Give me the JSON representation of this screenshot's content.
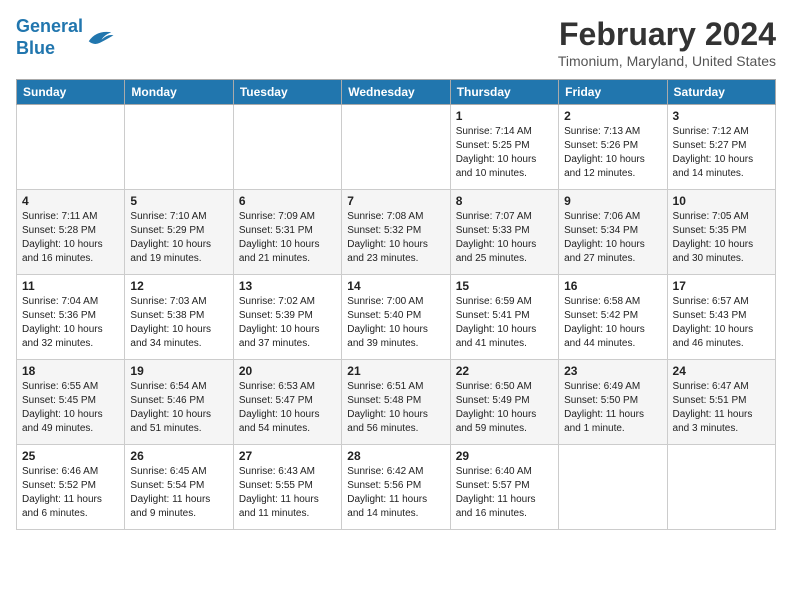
{
  "logo": {
    "line1": "General",
    "line2": "Blue"
  },
  "title": "February 2024",
  "subtitle": "Timonium, Maryland, United States",
  "days_of_week": [
    "Sunday",
    "Monday",
    "Tuesday",
    "Wednesday",
    "Thursday",
    "Friday",
    "Saturday"
  ],
  "weeks": [
    [
      {
        "day": "",
        "sunrise": "",
        "sunset": "",
        "daylight": ""
      },
      {
        "day": "",
        "sunrise": "",
        "sunset": "",
        "daylight": ""
      },
      {
        "day": "",
        "sunrise": "",
        "sunset": "",
        "daylight": ""
      },
      {
        "day": "",
        "sunrise": "",
        "sunset": "",
        "daylight": ""
      },
      {
        "day": "1",
        "sunrise": "Sunrise: 7:14 AM",
        "sunset": "Sunset: 5:25 PM",
        "daylight": "Daylight: 10 hours and 10 minutes."
      },
      {
        "day": "2",
        "sunrise": "Sunrise: 7:13 AM",
        "sunset": "Sunset: 5:26 PM",
        "daylight": "Daylight: 10 hours and 12 minutes."
      },
      {
        "day": "3",
        "sunrise": "Sunrise: 7:12 AM",
        "sunset": "Sunset: 5:27 PM",
        "daylight": "Daylight: 10 hours and 14 minutes."
      }
    ],
    [
      {
        "day": "4",
        "sunrise": "Sunrise: 7:11 AM",
        "sunset": "Sunset: 5:28 PM",
        "daylight": "Daylight: 10 hours and 16 minutes."
      },
      {
        "day": "5",
        "sunrise": "Sunrise: 7:10 AM",
        "sunset": "Sunset: 5:29 PM",
        "daylight": "Daylight: 10 hours and 19 minutes."
      },
      {
        "day": "6",
        "sunrise": "Sunrise: 7:09 AM",
        "sunset": "Sunset: 5:31 PM",
        "daylight": "Daylight: 10 hours and 21 minutes."
      },
      {
        "day": "7",
        "sunrise": "Sunrise: 7:08 AM",
        "sunset": "Sunset: 5:32 PM",
        "daylight": "Daylight: 10 hours and 23 minutes."
      },
      {
        "day": "8",
        "sunrise": "Sunrise: 7:07 AM",
        "sunset": "Sunset: 5:33 PM",
        "daylight": "Daylight: 10 hours and 25 minutes."
      },
      {
        "day": "9",
        "sunrise": "Sunrise: 7:06 AM",
        "sunset": "Sunset: 5:34 PM",
        "daylight": "Daylight: 10 hours and 27 minutes."
      },
      {
        "day": "10",
        "sunrise": "Sunrise: 7:05 AM",
        "sunset": "Sunset: 5:35 PM",
        "daylight": "Daylight: 10 hours and 30 minutes."
      }
    ],
    [
      {
        "day": "11",
        "sunrise": "Sunrise: 7:04 AM",
        "sunset": "Sunset: 5:36 PM",
        "daylight": "Daylight: 10 hours and 32 minutes."
      },
      {
        "day": "12",
        "sunrise": "Sunrise: 7:03 AM",
        "sunset": "Sunset: 5:38 PM",
        "daylight": "Daylight: 10 hours and 34 minutes."
      },
      {
        "day": "13",
        "sunrise": "Sunrise: 7:02 AM",
        "sunset": "Sunset: 5:39 PM",
        "daylight": "Daylight: 10 hours and 37 minutes."
      },
      {
        "day": "14",
        "sunrise": "Sunrise: 7:00 AM",
        "sunset": "Sunset: 5:40 PM",
        "daylight": "Daylight: 10 hours and 39 minutes."
      },
      {
        "day": "15",
        "sunrise": "Sunrise: 6:59 AM",
        "sunset": "Sunset: 5:41 PM",
        "daylight": "Daylight: 10 hours and 41 minutes."
      },
      {
        "day": "16",
        "sunrise": "Sunrise: 6:58 AM",
        "sunset": "Sunset: 5:42 PM",
        "daylight": "Daylight: 10 hours and 44 minutes."
      },
      {
        "day": "17",
        "sunrise": "Sunrise: 6:57 AM",
        "sunset": "Sunset: 5:43 PM",
        "daylight": "Daylight: 10 hours and 46 minutes."
      }
    ],
    [
      {
        "day": "18",
        "sunrise": "Sunrise: 6:55 AM",
        "sunset": "Sunset: 5:45 PM",
        "daylight": "Daylight: 10 hours and 49 minutes."
      },
      {
        "day": "19",
        "sunrise": "Sunrise: 6:54 AM",
        "sunset": "Sunset: 5:46 PM",
        "daylight": "Daylight: 10 hours and 51 minutes."
      },
      {
        "day": "20",
        "sunrise": "Sunrise: 6:53 AM",
        "sunset": "Sunset: 5:47 PM",
        "daylight": "Daylight: 10 hours and 54 minutes."
      },
      {
        "day": "21",
        "sunrise": "Sunrise: 6:51 AM",
        "sunset": "Sunset: 5:48 PM",
        "daylight": "Daylight: 10 hours and 56 minutes."
      },
      {
        "day": "22",
        "sunrise": "Sunrise: 6:50 AM",
        "sunset": "Sunset: 5:49 PM",
        "daylight": "Daylight: 10 hours and 59 minutes."
      },
      {
        "day": "23",
        "sunrise": "Sunrise: 6:49 AM",
        "sunset": "Sunset: 5:50 PM",
        "daylight": "Daylight: 11 hours and 1 minute."
      },
      {
        "day": "24",
        "sunrise": "Sunrise: 6:47 AM",
        "sunset": "Sunset: 5:51 PM",
        "daylight": "Daylight: 11 hours and 3 minutes."
      }
    ],
    [
      {
        "day": "25",
        "sunrise": "Sunrise: 6:46 AM",
        "sunset": "Sunset: 5:52 PM",
        "daylight": "Daylight: 11 hours and 6 minutes."
      },
      {
        "day": "26",
        "sunrise": "Sunrise: 6:45 AM",
        "sunset": "Sunset: 5:54 PM",
        "daylight": "Daylight: 11 hours and 9 minutes."
      },
      {
        "day": "27",
        "sunrise": "Sunrise: 6:43 AM",
        "sunset": "Sunset: 5:55 PM",
        "daylight": "Daylight: 11 hours and 11 minutes."
      },
      {
        "day": "28",
        "sunrise": "Sunrise: 6:42 AM",
        "sunset": "Sunset: 5:56 PM",
        "daylight": "Daylight: 11 hours and 14 minutes."
      },
      {
        "day": "29",
        "sunrise": "Sunrise: 6:40 AM",
        "sunset": "Sunset: 5:57 PM",
        "daylight": "Daylight: 11 hours and 16 minutes."
      },
      {
        "day": "",
        "sunrise": "",
        "sunset": "",
        "daylight": ""
      },
      {
        "day": "",
        "sunrise": "",
        "sunset": "",
        "daylight": ""
      }
    ]
  ]
}
